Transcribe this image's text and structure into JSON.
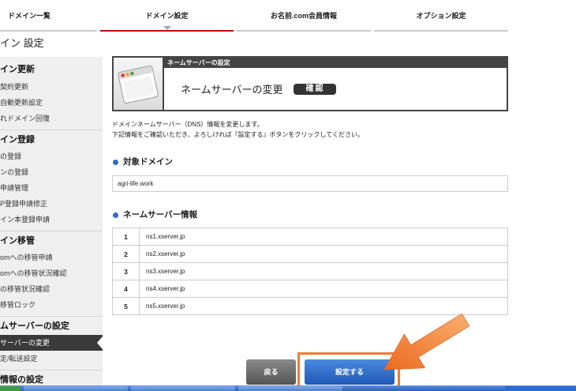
{
  "nav": {
    "tabs": [
      {
        "label": "ドメイン一覧",
        "active": false
      },
      {
        "label": "ドメイン設定",
        "active": true
      },
      {
        "label": "お名前.com会員情報",
        "active": false
      },
      {
        "label": "オプション設定",
        "active": false
      }
    ]
  },
  "page": {
    "title": "イン 設定"
  },
  "sidebar": {
    "sections": [
      {
        "title": "イン更新",
        "items": [
          {
            "label": "契約更新"
          },
          {
            "label": "自動更新設定"
          },
          {
            "label": "れドメイン回復"
          }
        ]
      },
      {
        "title": "イン登録",
        "items": [
          {
            "label": "の登録"
          },
          {
            "label": "ンの登録"
          },
          {
            "label": "申請管理"
          },
          {
            "label": "P登録申請修正"
          },
          {
            "label": "イン本登録申請"
          }
        ]
      },
      {
        "title": "イン移管",
        "items": [
          {
            "label": "omへの移管申請"
          },
          {
            "label": "omへの移管状況確認"
          },
          {
            "label": "の移管状況確認"
          },
          {
            "label": "移管ロック"
          }
        ]
      },
      {
        "title": "ムサーバーの設定",
        "items": [
          {
            "label": "サーバーの変更",
            "active": true
          },
          {
            "label": "定/転送設定"
          }
        ]
      },
      {
        "title": "情報の設定",
        "items": []
      }
    ]
  },
  "panel": {
    "header": "ネームサーバーの設定",
    "title": "ネームサーバーの変更",
    "badge": "確認"
  },
  "description": {
    "line1": "ドメインネームサーバー（DNS）情報を変更します。",
    "line2": "下記情報をご確認いただき、よろしければ『設定する』ボタンをクリックしてください。"
  },
  "target_domain": {
    "heading": "対象ドメイン",
    "value": "agri-life.work"
  },
  "nameservers": {
    "heading": "ネームサーバー情報",
    "rows": [
      {
        "no": "1",
        "host": "ns1.xserver.jp"
      },
      {
        "no": "2",
        "host": "ns2.xserver.jp"
      },
      {
        "no": "3",
        "host": "ns3.xserver.jp"
      },
      {
        "no": "4",
        "host": "ns4.xserver.jp"
      },
      {
        "no": "5",
        "host": "ns5.xserver.jp"
      }
    ]
  },
  "buttons": {
    "back": "戻る",
    "submit": "設定する"
  },
  "icons": {
    "panel": "window-icon",
    "bullet": "bullet-dot-icon",
    "pointer": "orange-arrow-icon"
  },
  "colors": {
    "active_tab_underline": "#c30d0d",
    "sidebar_bg": "#efefef",
    "sidebar_active_bg": "#3a3a3a",
    "panel_frame": "#454545",
    "bullet": "#2f6bcf",
    "back_button": "#6e6e6e",
    "submit_button": "#2a67c8",
    "highlight": "#f07a36"
  }
}
